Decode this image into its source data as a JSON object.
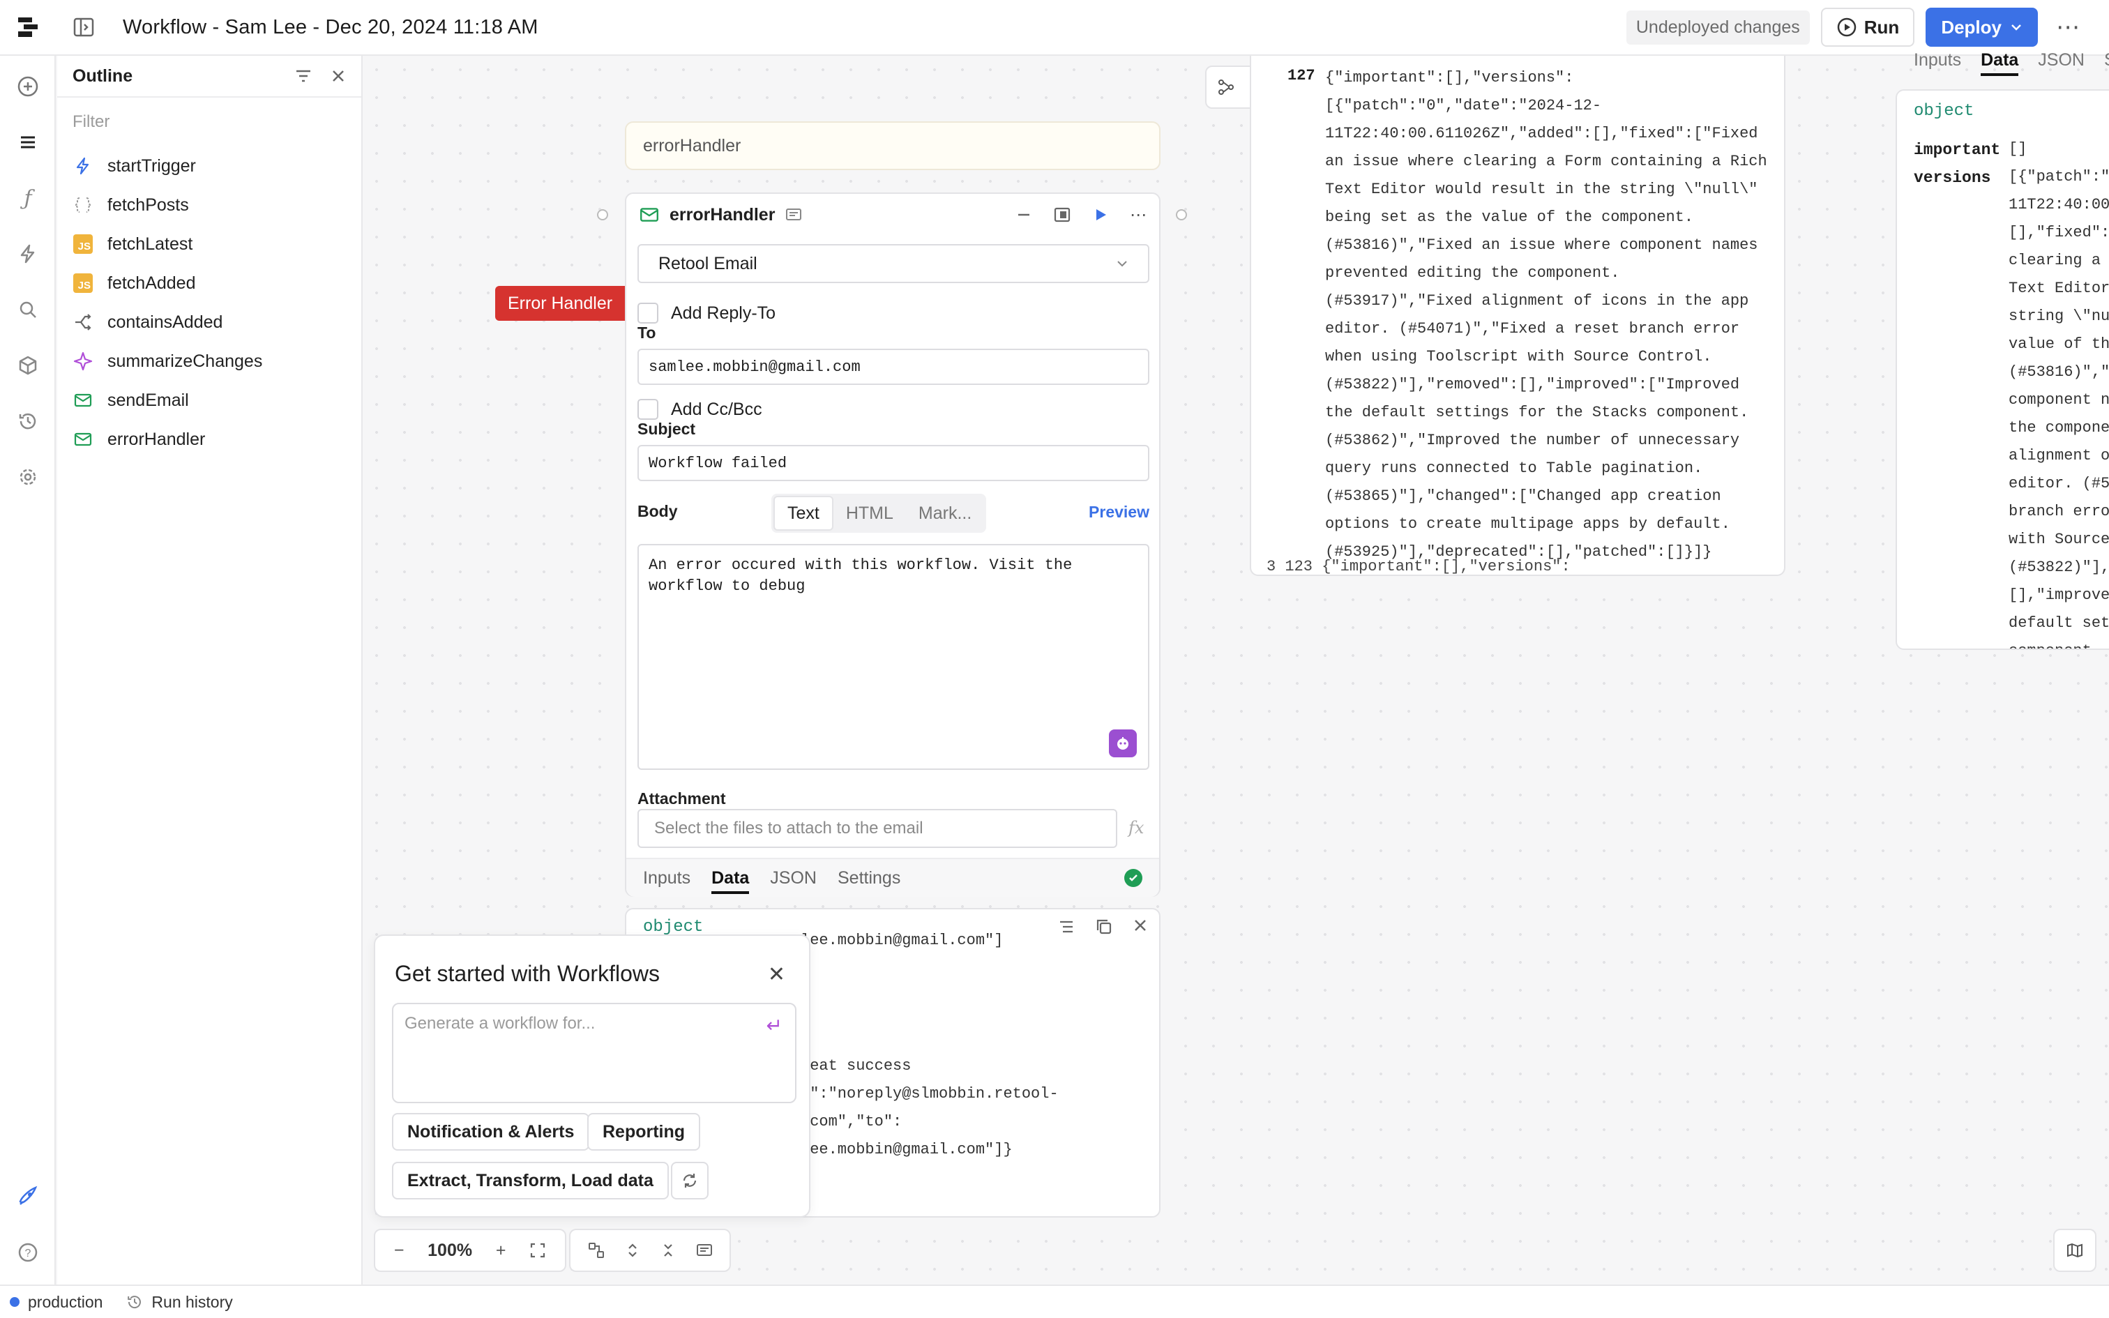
{
  "header": {
    "title": "Workflow - Sam Lee - Dec 20, 2024 11:18 AM",
    "undeployed": "Undeployed changes",
    "run_label": "Run",
    "deploy_label": "Deploy",
    "colors": {
      "deploy": "#3b71e6",
      "error_tag": "#d6332f"
    }
  },
  "outline": {
    "title": "Outline",
    "filter_placeholder": "Filter",
    "items": [
      {
        "label": "startTrigger",
        "icon": "bolt-icon"
      },
      {
        "label": "fetchPosts",
        "icon": "curly-braces-icon"
      },
      {
        "label": "fetchLatest",
        "icon": "js-icon"
      },
      {
        "label": "fetchAdded",
        "icon": "js-icon"
      },
      {
        "label": "containsAdded",
        "icon": "branch-icon"
      },
      {
        "label": "summarizeChanges",
        "icon": "sparkle-icon"
      },
      {
        "label": "sendEmail",
        "icon": "mail-icon"
      },
      {
        "label": "errorHandler",
        "icon": "mail-icon"
      }
    ],
    "js_badge": "JS"
  },
  "canvas": {
    "block_title": "errorHandler",
    "error_tag": "Error Handler",
    "card": {
      "name": "errorHandler",
      "resource": "Retool Email",
      "add_reply_to": "Add Reply-To",
      "to_label": "To",
      "to_value": "samlee.mobbin@gmail.com",
      "add_cc": "Add Cc/Bcc",
      "subject_label": "Subject",
      "subject_value": "Workflow failed",
      "body_label": "Body",
      "body_tabs": [
        "Text",
        "HTML",
        "Mark..."
      ],
      "preview": "Preview",
      "body_value": "An error occured with this workflow. Visit the workflow to debug",
      "attachment_label": "Attachment",
      "attachment_placeholder": "Select the files to attach to the email",
      "fx": "fx",
      "tabs": [
        "Inputs",
        "Data",
        "JSON",
        "Settings"
      ],
      "active_tab": "Data"
    },
    "output": {
      "type": "object",
      "lines": [
        "lee.mobbin@gmail.com\"]",
        "reat success",
        "m\":\"noreply@slmobbin.retool-",
        ".com\",\"to\":",
        "lee.mobbin@gmail.com\"]}"
      ]
    },
    "get_started": {
      "title": "Get started with Workflows",
      "placeholder": "Generate a workflow for...",
      "chips": [
        "Notification & Alerts",
        "Reporting",
        "Extract, Transform, Load data"
      ]
    },
    "zoom": "100%"
  },
  "json_panel": {
    "row_num": "127",
    "text": "{\"important\":[],\"versions\":\n[{\"patch\":\"0\",\"date\":\"2024-12-\n11T22:40:00.611026Z\",\"added\":[],\"fixed\":[\"Fixed\nan issue where clearing a Form containing a Rich\nText Editor would result in the string \\\"null\\\"\nbeing set as the value of the component.\n(#53816)\",\"Fixed an issue where component names\nprevented editing the component.\n(#53917)\",\"Fixed alignment of icons in the app\neditor. (#54071)\",\"Fixed a reset branch error\nwhen using Toolscript with Source Control.\n(#53822)\"],\"removed\":[],\"improved\":[\"Improved\nthe default settings for the Stacks component.\n(#53862)\",\"Improved the number of unnecessary\nquery runs connected to Table pagination.\n(#53865)\"],\"changed\":[\"Changed app creation\noptions to create multipage apps by default.\n(#53925)\"],\"deprecated\":[],\"patched\":[]}]}",
    "next_row": "3  123  {\"important\":[],\"versions\":"
  },
  "right_panel": {
    "tabs": [
      "Inputs",
      "Data",
      "JSON",
      "S"
    ],
    "active_tab": "Data",
    "type": "object",
    "important_key": "important",
    "important_val": "[]",
    "versions_key": "versions",
    "versions_val": "[{\"patch\":\"\n11T22:40:00\n[],\"fixed\":\nclearing a \nText Editor\nstring \\\"nu\nvalue of th\n(#53816)\",\"\ncomponent n\nthe compone\nalignment o\neditor. (#5\nbranch erro\nwith Source\n(#53822)\"],\n[],\"improve\ndefault set\ncomponent"
  },
  "bottombar": {
    "env": "production",
    "history": "Run history"
  }
}
